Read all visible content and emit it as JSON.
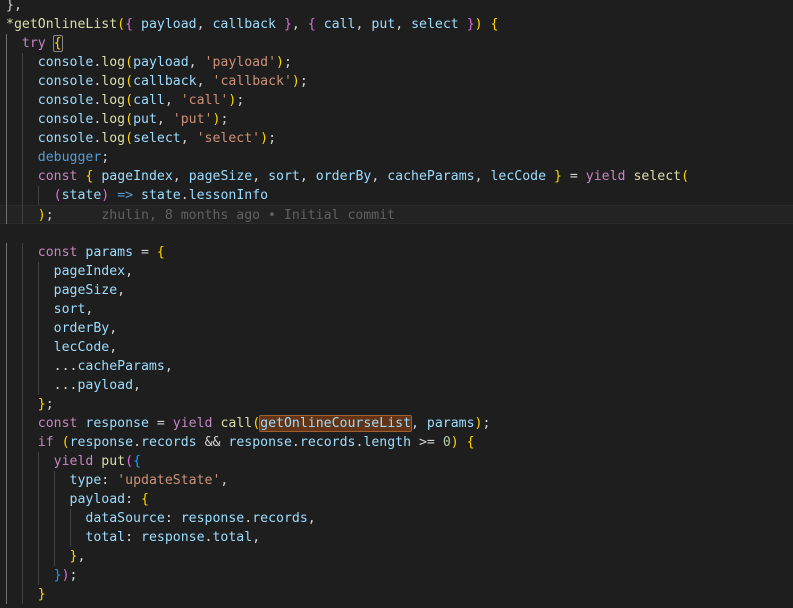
{
  "editor": {
    "name": "code-editor",
    "language": "javascript",
    "theme": "dark-plus",
    "font_size_px": 13,
    "line_height_px": 19,
    "colors": {
      "background": "#1e1e1e",
      "foreground": "#d4d4d4",
      "current_line_background": "#232323",
      "keyword": "#c586c0",
      "keyword_alt": "#569cd6",
      "function": "#dcdcaa",
      "variable": "#9cdcfe",
      "string": "#ce9178",
      "number": "#b5cea8",
      "indent_guide": "#404040",
      "indent_guide_active": "#707070",
      "word_highlight_background": "#623315",
      "word_highlight_border": "#a06030",
      "blame_text": "#6b6b6b"
    }
  },
  "blame_annotation": {
    "author": "zhulin",
    "when": "8 months ago",
    "separator": "•",
    "message": "Initial commit",
    "full_text": "zhulin, 8 months ago • Initial commit"
  },
  "highlighted_word": "getOnlineCourseList",
  "code": {
    "lines": [
      {
        "n": 1,
        "indent": 0,
        "current": false,
        "tokens": [
          {
            "t": "punc",
            "v": "},"
          }
        ]
      },
      {
        "n": 2,
        "indent": 0,
        "current": false,
        "tokens": [
          {
            "t": "fn",
            "v": "*getOnlineList"
          },
          {
            "t": "b1",
            "v": "("
          },
          {
            "t": "b2",
            "v": "{"
          },
          {
            "t": "plain",
            "v": " "
          },
          {
            "t": "var",
            "v": "payload"
          },
          {
            "t": "punc",
            "v": ", "
          },
          {
            "t": "var",
            "v": "callback"
          },
          {
            "t": "plain",
            "v": " "
          },
          {
            "t": "b2",
            "v": "}"
          },
          {
            "t": "punc",
            "v": ", "
          },
          {
            "t": "b2",
            "v": "{"
          },
          {
            "t": "plain",
            "v": " "
          },
          {
            "t": "var",
            "v": "call"
          },
          {
            "t": "punc",
            "v": ", "
          },
          {
            "t": "var",
            "v": "put"
          },
          {
            "t": "punc",
            "v": ", "
          },
          {
            "t": "var",
            "v": "select"
          },
          {
            "t": "plain",
            "v": " "
          },
          {
            "t": "b2",
            "v": "}"
          },
          {
            "t": "b1",
            "v": ")"
          },
          {
            "t": "plain",
            "v": " "
          },
          {
            "t": "b1",
            "v": "{"
          }
        ]
      },
      {
        "n": 3,
        "indent": 1,
        "current": false,
        "tokens": [
          {
            "t": "kw",
            "v": "try"
          },
          {
            "t": "plain",
            "v": " "
          },
          {
            "t": "b1 bracket-match",
            "v": "{"
          }
        ]
      },
      {
        "n": 4,
        "indent": 2,
        "current": false,
        "tokens": [
          {
            "t": "var",
            "v": "console"
          },
          {
            "t": "punc",
            "v": "."
          },
          {
            "t": "fn",
            "v": "log"
          },
          {
            "t": "b1",
            "v": "("
          },
          {
            "t": "var",
            "v": "payload"
          },
          {
            "t": "punc",
            "v": ", "
          },
          {
            "t": "str",
            "v": "'payload'"
          },
          {
            "t": "b1",
            "v": ")"
          },
          {
            "t": "punc",
            "v": ";"
          }
        ]
      },
      {
        "n": 5,
        "indent": 2,
        "current": false,
        "tokens": [
          {
            "t": "var",
            "v": "console"
          },
          {
            "t": "punc",
            "v": "."
          },
          {
            "t": "fn",
            "v": "log"
          },
          {
            "t": "b1",
            "v": "("
          },
          {
            "t": "var",
            "v": "callback"
          },
          {
            "t": "punc",
            "v": ", "
          },
          {
            "t": "str",
            "v": "'callback'"
          },
          {
            "t": "b1",
            "v": ")"
          },
          {
            "t": "punc",
            "v": ";"
          }
        ]
      },
      {
        "n": 6,
        "indent": 2,
        "current": false,
        "tokens": [
          {
            "t": "var",
            "v": "console"
          },
          {
            "t": "punc",
            "v": "."
          },
          {
            "t": "fn",
            "v": "log"
          },
          {
            "t": "b1",
            "v": "("
          },
          {
            "t": "var",
            "v": "call"
          },
          {
            "t": "punc",
            "v": ", "
          },
          {
            "t": "str",
            "v": "'call'"
          },
          {
            "t": "b1",
            "v": ")"
          },
          {
            "t": "punc",
            "v": ";"
          }
        ]
      },
      {
        "n": 7,
        "indent": 2,
        "current": false,
        "tokens": [
          {
            "t": "var",
            "v": "console"
          },
          {
            "t": "punc",
            "v": "."
          },
          {
            "t": "fn",
            "v": "log"
          },
          {
            "t": "b1",
            "v": "("
          },
          {
            "t": "var",
            "v": "put"
          },
          {
            "t": "punc",
            "v": ", "
          },
          {
            "t": "str",
            "v": "'put'"
          },
          {
            "t": "b1",
            "v": ")"
          },
          {
            "t": "punc",
            "v": ";"
          }
        ]
      },
      {
        "n": 8,
        "indent": 2,
        "current": false,
        "tokens": [
          {
            "t": "var",
            "v": "console"
          },
          {
            "t": "punc",
            "v": "."
          },
          {
            "t": "fn",
            "v": "log"
          },
          {
            "t": "b1",
            "v": "("
          },
          {
            "t": "var",
            "v": "select"
          },
          {
            "t": "punc",
            "v": ", "
          },
          {
            "t": "str",
            "v": "'select'"
          },
          {
            "t": "b1",
            "v": ")"
          },
          {
            "t": "punc",
            "v": ";"
          }
        ]
      },
      {
        "n": 9,
        "indent": 2,
        "current": false,
        "tokens": [
          {
            "t": "kw2",
            "v": "debugger"
          },
          {
            "t": "punc",
            "v": ";"
          }
        ]
      },
      {
        "n": 10,
        "indent": 2,
        "current": false,
        "tokens": [
          {
            "t": "kw",
            "v": "const"
          },
          {
            "t": "plain",
            "v": " "
          },
          {
            "t": "b1",
            "v": "{"
          },
          {
            "t": "plain",
            "v": " "
          },
          {
            "t": "var",
            "v": "pageIndex"
          },
          {
            "t": "punc",
            "v": ", "
          },
          {
            "t": "var",
            "v": "pageSize"
          },
          {
            "t": "punc",
            "v": ", "
          },
          {
            "t": "var",
            "v": "sort"
          },
          {
            "t": "punc",
            "v": ", "
          },
          {
            "t": "var",
            "v": "orderBy"
          },
          {
            "t": "punc",
            "v": ", "
          },
          {
            "t": "var",
            "v": "cacheParams"
          },
          {
            "t": "punc",
            "v": ", "
          },
          {
            "t": "var",
            "v": "lecCode"
          },
          {
            "t": "plain",
            "v": " "
          },
          {
            "t": "b1",
            "v": "}"
          },
          {
            "t": "op",
            "v": " = "
          },
          {
            "t": "kw",
            "v": "yield"
          },
          {
            "t": "plain",
            "v": " "
          },
          {
            "t": "fn",
            "v": "select"
          },
          {
            "t": "b1",
            "v": "("
          }
        ]
      },
      {
        "n": 11,
        "indent": 3,
        "current": false,
        "tokens": [
          {
            "t": "b2",
            "v": "("
          },
          {
            "t": "var",
            "v": "state"
          },
          {
            "t": "b2",
            "v": ")"
          },
          {
            "t": "plain",
            "v": " "
          },
          {
            "t": "kw2",
            "v": "=>"
          },
          {
            "t": "plain",
            "v": " "
          },
          {
            "t": "var",
            "v": "state"
          },
          {
            "t": "punc",
            "v": "."
          },
          {
            "t": "var",
            "v": "lessonInfo"
          }
        ]
      },
      {
        "n": 12,
        "indent": 2,
        "current": true,
        "tokens": [
          {
            "t": "b1",
            "v": ")"
          },
          {
            "t": "punc",
            "v": ";"
          },
          {
            "t": "blame-gap",
            "v": "      "
          },
          {
            "t": "blame",
            "v": "zhulin, 8 months ago • Initial commit"
          }
        ]
      },
      {
        "n": 13,
        "indent": 0,
        "current": false,
        "tokens": []
      },
      {
        "n": 14,
        "indent": 2,
        "current": false,
        "tokens": [
          {
            "t": "kw",
            "v": "const"
          },
          {
            "t": "plain",
            "v": " "
          },
          {
            "t": "var",
            "v": "params"
          },
          {
            "t": "op",
            "v": " = "
          },
          {
            "t": "b1",
            "v": "{"
          }
        ]
      },
      {
        "n": 15,
        "indent": 3,
        "current": false,
        "tokens": [
          {
            "t": "var",
            "v": "pageIndex"
          },
          {
            "t": "punc",
            "v": ","
          }
        ]
      },
      {
        "n": 16,
        "indent": 3,
        "current": false,
        "tokens": [
          {
            "t": "var",
            "v": "pageSize"
          },
          {
            "t": "punc",
            "v": ","
          }
        ]
      },
      {
        "n": 17,
        "indent": 3,
        "current": false,
        "tokens": [
          {
            "t": "var",
            "v": "sort"
          },
          {
            "t": "punc",
            "v": ","
          }
        ]
      },
      {
        "n": 18,
        "indent": 3,
        "current": false,
        "tokens": [
          {
            "t": "var",
            "v": "orderBy"
          },
          {
            "t": "punc",
            "v": ","
          }
        ]
      },
      {
        "n": 19,
        "indent": 3,
        "current": false,
        "tokens": [
          {
            "t": "var",
            "v": "lecCode"
          },
          {
            "t": "punc",
            "v": ","
          }
        ]
      },
      {
        "n": 20,
        "indent": 3,
        "current": false,
        "tokens": [
          {
            "t": "punc",
            "v": "..."
          },
          {
            "t": "var",
            "v": "cacheParams"
          },
          {
            "t": "punc",
            "v": ","
          }
        ]
      },
      {
        "n": 21,
        "indent": 3,
        "current": false,
        "tokens": [
          {
            "t": "punc",
            "v": "..."
          },
          {
            "t": "var",
            "v": "payload"
          },
          {
            "t": "punc",
            "v": ","
          }
        ]
      },
      {
        "n": 22,
        "indent": 2,
        "current": false,
        "tokens": [
          {
            "t": "b1",
            "v": "}"
          },
          {
            "t": "punc",
            "v": ";"
          }
        ]
      },
      {
        "n": 23,
        "indent": 2,
        "current": false,
        "tokens": [
          {
            "t": "kw",
            "v": "const"
          },
          {
            "t": "plain",
            "v": " "
          },
          {
            "t": "var",
            "v": "response"
          },
          {
            "t": "op",
            "v": " = "
          },
          {
            "t": "kw",
            "v": "yield"
          },
          {
            "t": "plain",
            "v": " "
          },
          {
            "t": "fn",
            "v": "call"
          },
          {
            "t": "b1",
            "v": "("
          },
          {
            "t": "var hl-word",
            "v": "getOnlineCourseList"
          },
          {
            "t": "punc",
            "v": ", "
          },
          {
            "t": "var",
            "v": "params"
          },
          {
            "t": "b1",
            "v": ")"
          },
          {
            "t": "punc",
            "v": ";"
          }
        ]
      },
      {
        "n": 24,
        "indent": 2,
        "current": false,
        "tokens": [
          {
            "t": "kw",
            "v": "if"
          },
          {
            "t": "plain",
            "v": " "
          },
          {
            "t": "b1",
            "v": "("
          },
          {
            "t": "var",
            "v": "response"
          },
          {
            "t": "punc",
            "v": "."
          },
          {
            "t": "var",
            "v": "records"
          },
          {
            "t": "op",
            "v": " && "
          },
          {
            "t": "var",
            "v": "response"
          },
          {
            "t": "punc",
            "v": "."
          },
          {
            "t": "var",
            "v": "records"
          },
          {
            "t": "punc",
            "v": "."
          },
          {
            "t": "var",
            "v": "length"
          },
          {
            "t": "op",
            "v": " >= "
          },
          {
            "t": "num",
            "v": "0"
          },
          {
            "t": "b1",
            "v": ")"
          },
          {
            "t": "plain",
            "v": " "
          },
          {
            "t": "b1",
            "v": "{"
          }
        ]
      },
      {
        "n": 25,
        "indent": 3,
        "current": false,
        "tokens": [
          {
            "t": "kw",
            "v": "yield"
          },
          {
            "t": "plain",
            "v": " "
          },
          {
            "t": "fn",
            "v": "put"
          },
          {
            "t": "b2",
            "v": "("
          },
          {
            "t": "b3",
            "v": "{"
          }
        ]
      },
      {
        "n": 26,
        "indent": 4,
        "current": false,
        "tokens": [
          {
            "t": "var",
            "v": "type"
          },
          {
            "t": "punc",
            "v": ": "
          },
          {
            "t": "str",
            "v": "'updateState'"
          },
          {
            "t": "punc",
            "v": ","
          }
        ]
      },
      {
        "n": 27,
        "indent": 4,
        "current": false,
        "tokens": [
          {
            "t": "var",
            "v": "payload"
          },
          {
            "t": "punc",
            "v": ": "
          },
          {
            "t": "b1",
            "v": "{"
          }
        ]
      },
      {
        "n": 28,
        "indent": 5,
        "current": false,
        "tokens": [
          {
            "t": "var",
            "v": "dataSource"
          },
          {
            "t": "punc",
            "v": ": "
          },
          {
            "t": "var",
            "v": "response"
          },
          {
            "t": "punc",
            "v": "."
          },
          {
            "t": "var",
            "v": "records"
          },
          {
            "t": "punc",
            "v": ","
          }
        ]
      },
      {
        "n": 29,
        "indent": 5,
        "current": false,
        "tokens": [
          {
            "t": "var",
            "v": "total"
          },
          {
            "t": "punc",
            "v": ": "
          },
          {
            "t": "var",
            "v": "response"
          },
          {
            "t": "punc",
            "v": "."
          },
          {
            "t": "var",
            "v": "total"
          },
          {
            "t": "punc",
            "v": ","
          }
        ]
      },
      {
        "n": 30,
        "indent": 4,
        "current": false,
        "tokens": [
          {
            "t": "b1",
            "v": "}"
          },
          {
            "t": "punc",
            "v": ","
          }
        ]
      },
      {
        "n": 31,
        "indent": 3,
        "current": false,
        "tokens": [
          {
            "t": "b3",
            "v": "}"
          },
          {
            "t": "b2",
            "v": ")"
          },
          {
            "t": "punc",
            "v": ";"
          }
        ]
      },
      {
        "n": 32,
        "indent": 2,
        "current": false,
        "tokens": [
          {
            "t": "b1",
            "v": "}"
          }
        ]
      }
    ]
  }
}
